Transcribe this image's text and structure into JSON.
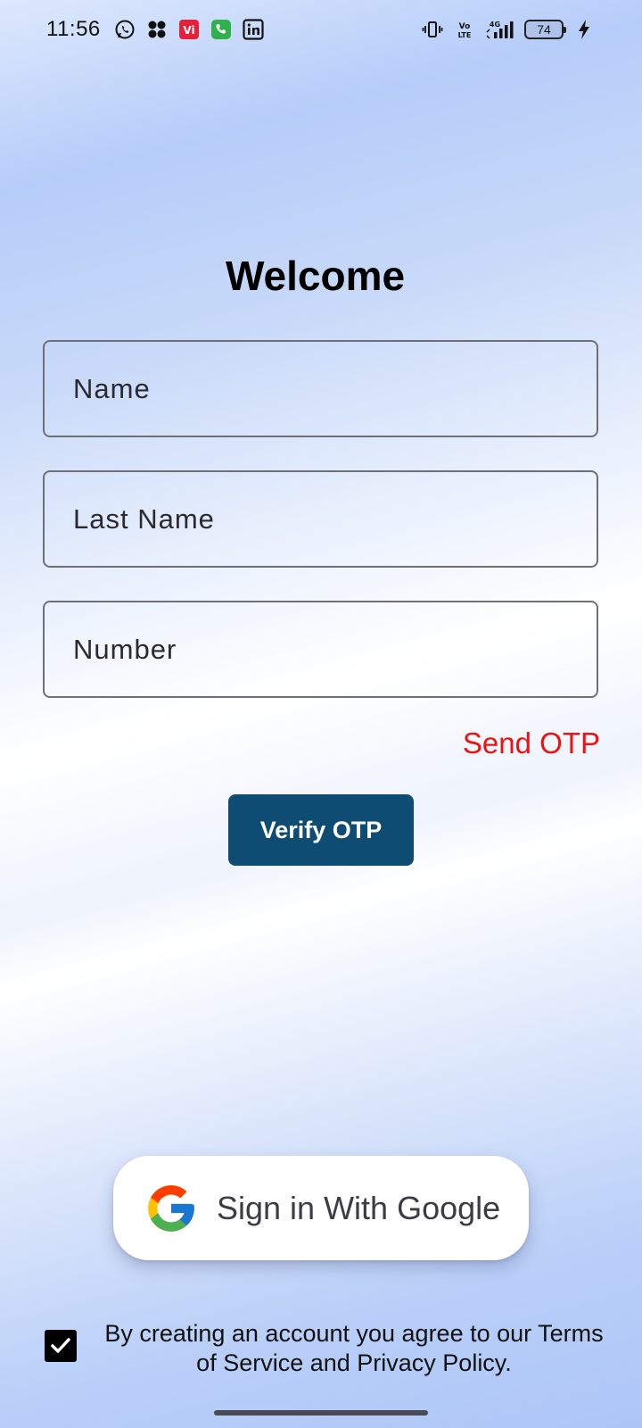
{
  "status_bar": {
    "time": "11:56",
    "left_icons": [
      "whatsapp-icon",
      "app-grid-icon",
      "vi-app-icon",
      "phone-app-icon",
      "linkedin-icon"
    ],
    "right_icons": [
      "vibrate-icon",
      "volte-icon",
      "signal-4g-icon",
      "battery-icon",
      "charging-icon"
    ],
    "battery_level": "74"
  },
  "form": {
    "title": "Welcome",
    "name_placeholder": "Name",
    "last_name_placeholder": "Last Name",
    "number_placeholder": "Number",
    "send_otp_label": "Send OTP",
    "verify_otp_label": "Verify OTP"
  },
  "google": {
    "label": "Sign in With Google"
  },
  "terms": {
    "checked": true,
    "text": "By creating an account you agree to our Terms of Service and Privacy Policy."
  },
  "colors": {
    "accent_button": "#0f4c73",
    "send_otp": "#ee1111",
    "checkbox": "#000000"
  }
}
